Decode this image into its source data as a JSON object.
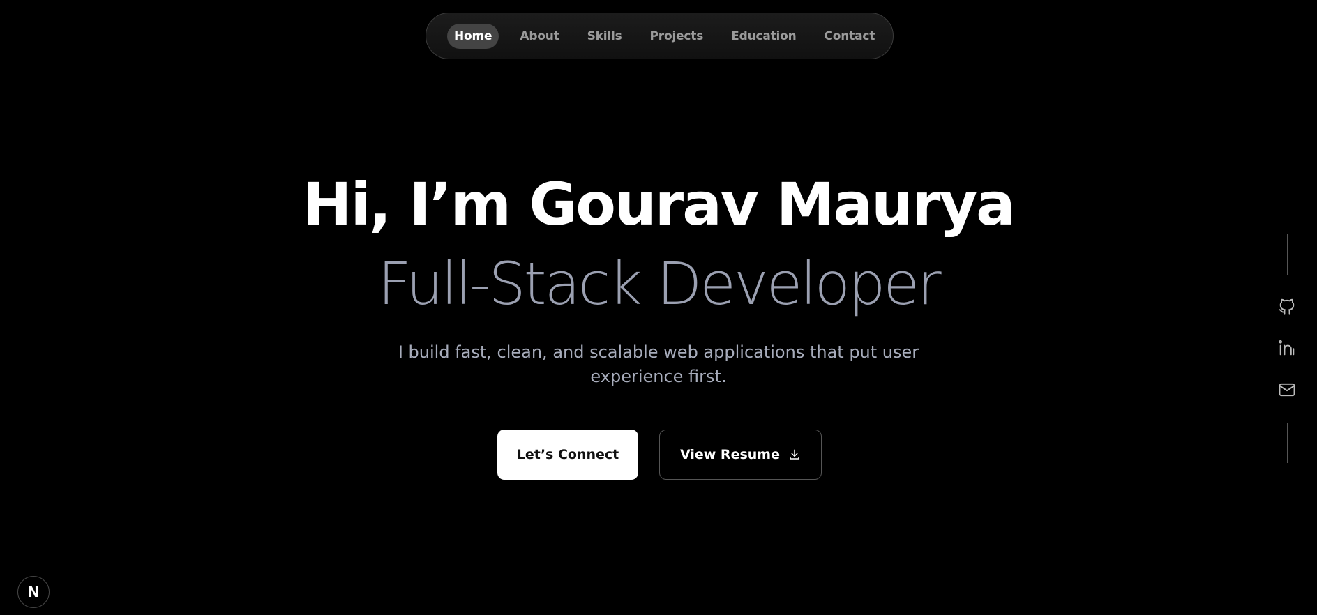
{
  "nav": {
    "items": [
      {
        "label": "Home",
        "active": true
      },
      {
        "label": "About"
      },
      {
        "label": "Skills"
      },
      {
        "label": "Projects"
      },
      {
        "label": "Education"
      },
      {
        "label": "Contact"
      }
    ]
  },
  "hero": {
    "title": "Hi, I’m Gourav Maurya",
    "role": "Full-Stack Developer",
    "description": "I build fast, clean, and scalable web applications that put user experience first."
  },
  "buttons": {
    "connect_label": "Let’s Connect",
    "resume_label": "View Resume"
  },
  "social": {
    "icons": [
      "github-icon",
      "linkedin-icon",
      "mail-icon"
    ]
  },
  "badge": {
    "letter": "N"
  },
  "colors": {
    "background": "#000000",
    "role_text": "#9ba0b1",
    "nav_active_bg": "#444444"
  }
}
